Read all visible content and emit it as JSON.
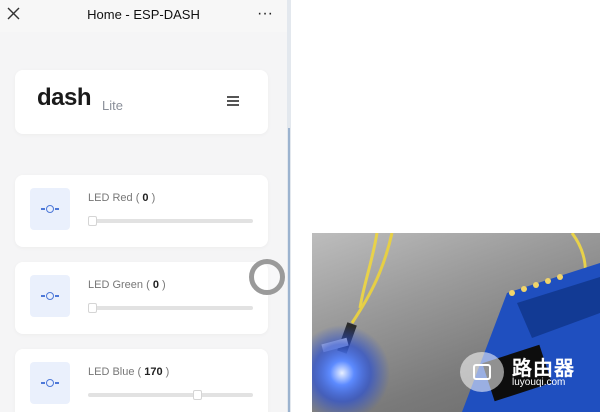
{
  "app": {
    "title": "Home - ESP-DASH",
    "more_label": "···"
  },
  "brand": {
    "name": "dash",
    "sub": "Lite"
  },
  "leds": [
    {
      "name": "LED Red",
      "value": "0",
      "level": 0.0
    },
    {
      "name": "LED Green",
      "value": "0",
      "level": 0.0
    },
    {
      "name": "LED Blue",
      "value": "170",
      "level": 0.67
    }
  ],
  "watermark": {
    "name": "路由器",
    "site": "luyouqi.com"
  },
  "colors": {
    "accent": "#4d78d8",
    "icon_bg": "#eaf0fc",
    "led_glow": "#3a6bff"
  }
}
